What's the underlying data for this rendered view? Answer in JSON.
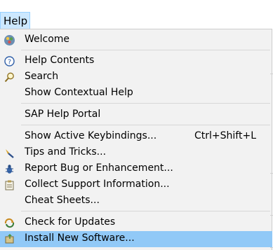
{
  "menubar": {
    "help_label": "Help"
  },
  "menu": {
    "welcome": "Welcome",
    "help_contents": "Help Contents",
    "search": "Search",
    "show_contextual_help": "Show Contextual Help",
    "sap_help_portal": "SAP Help Portal",
    "show_active_keybindings": "Show Active Keybindings...",
    "show_active_keybindings_shortcut": "Ctrl+Shift+L",
    "tips_and_tricks": "Tips and Tricks...",
    "report_bug": "Report Bug or Enhancement...",
    "collect_support": "Collect Support Information...",
    "cheat_sheets": "Cheat Sheets...",
    "check_for_updates": "Check for Updates",
    "install_new_software": "Install New Software..."
  },
  "icons": {
    "welcome": "welcome-icon",
    "help_contents": "help-icon",
    "search": "search-icon",
    "tips": "tips-icon",
    "report_bug": "bug-icon",
    "collect_support": "clipboard-icon",
    "check_updates": "update-icon",
    "install": "install-icon"
  },
  "colors": {
    "selection": "#91c9f7",
    "menubar_active": "#cce8ff"
  }
}
